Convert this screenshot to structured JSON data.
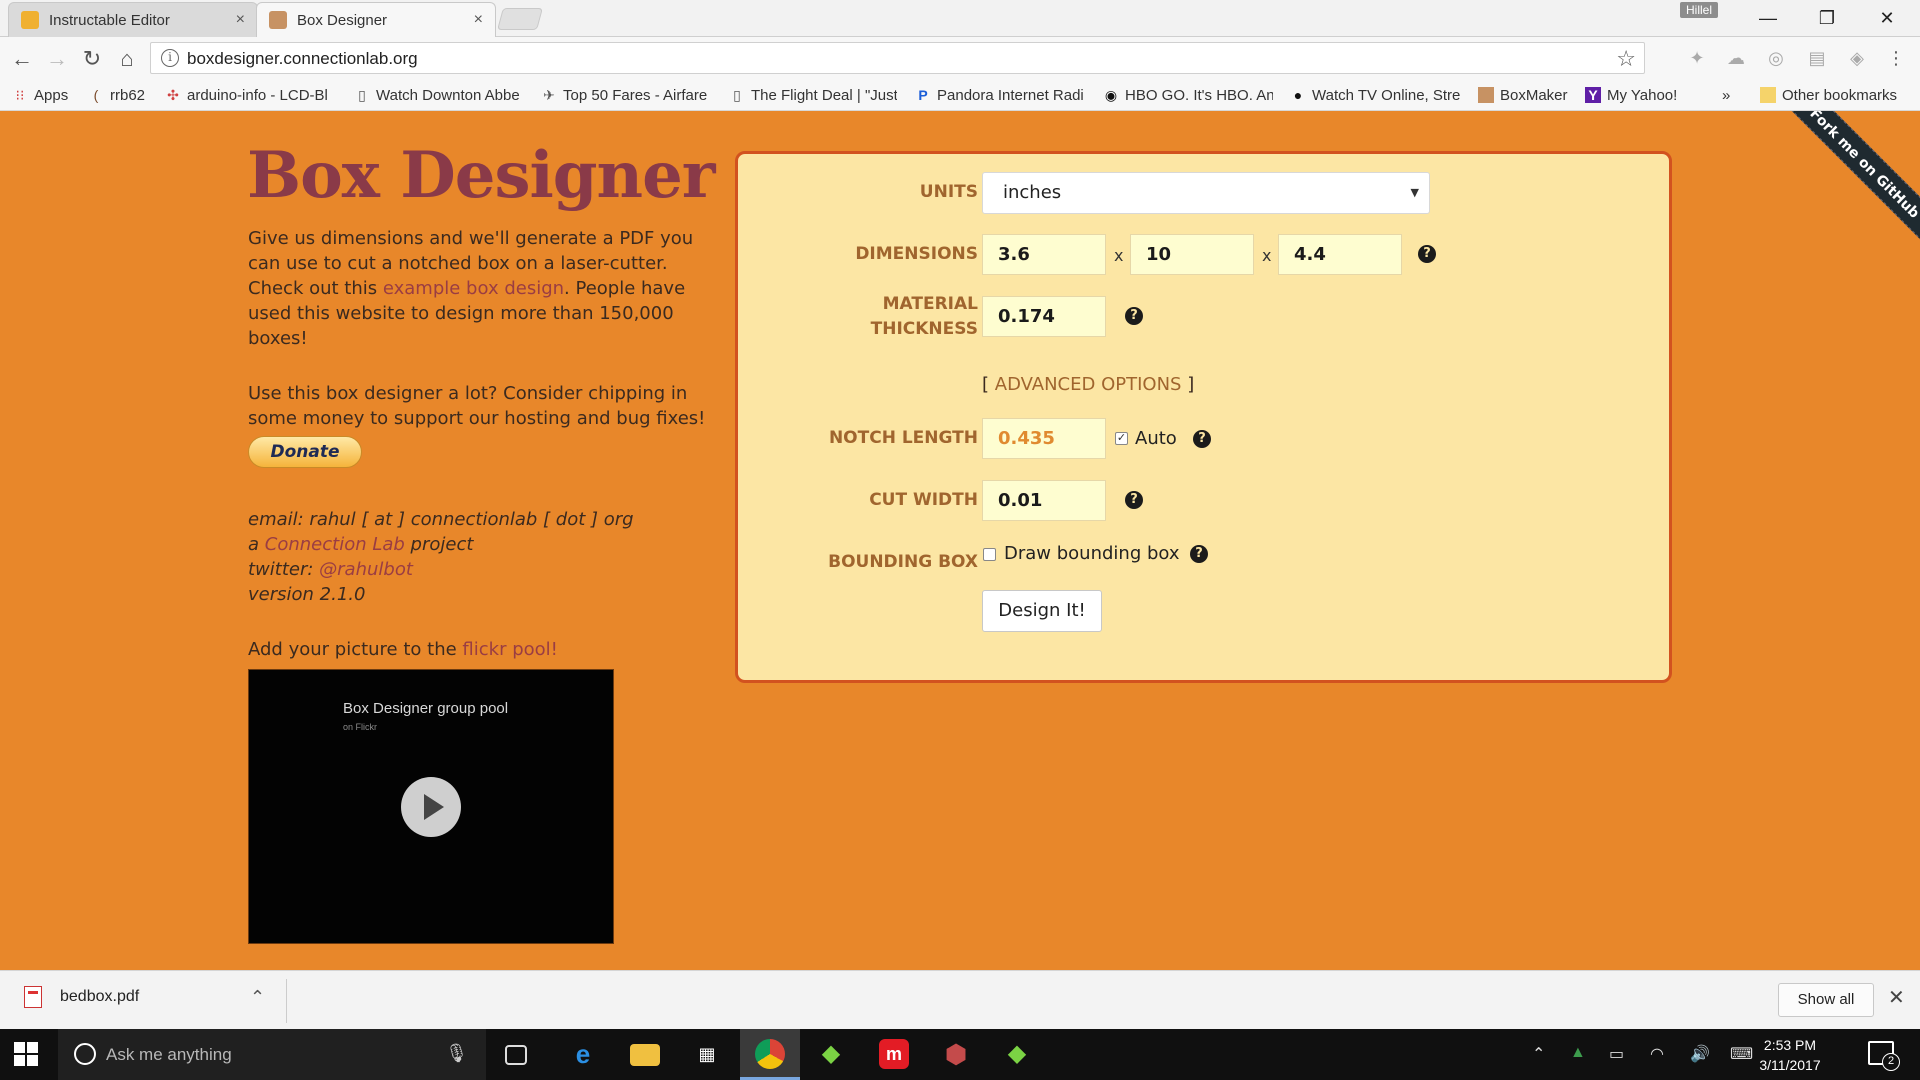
{
  "browser": {
    "tabs": [
      {
        "label": "Instructable Editor",
        "close": "×"
      },
      {
        "label": "Box Designer",
        "close": "×"
      }
    ],
    "profile_name": "Hillel",
    "window_buttons": {
      "minimize": "—",
      "restore": "❐",
      "close": "✕"
    },
    "url": "boxdesigner.connectionlab.org",
    "bookmarks": [
      {
        "label": "Apps",
        "icon": "apps-grid-icon"
      },
      {
        "label": "rrb62",
        "icon": "bookmark-favicon"
      },
      {
        "label": "arduino-info - LCD-Bl",
        "icon": "bookmark-favicon"
      },
      {
        "label": "Watch Downton Abbe",
        "icon": "page-icon"
      },
      {
        "label": "Top 50 Fares - Airfare",
        "icon": "plane-icon"
      },
      {
        "label": "The Flight Deal | \"Just",
        "icon": "page-icon"
      },
      {
        "label": "Pandora Internet Radi",
        "icon": "pandora-icon"
      },
      {
        "label": "HBO GO. It's HBO. An",
        "icon": "hbo-icon"
      },
      {
        "label": "Watch TV Online, Stre",
        "icon": "play-icon"
      },
      {
        "label": "BoxMaker",
        "icon": "boxmaker-icon"
      },
      {
        "label": "My Yahoo!",
        "icon": "yahoo-icon"
      }
    ],
    "bookmarks_overflow": "»",
    "other_bookmarks": "Other bookmarks"
  },
  "page": {
    "title": "Box Designer",
    "intro_before": "Give us dimensions and we'll generate a PDF you can use to cut a notched box on a laser-cutter. Check out this ",
    "intro_link": "example box design",
    "intro_after": ". People have used this website to design more than 150,000 boxes!",
    "donate_text": "Use this box designer a lot? Consider chipping in some money to support our hosting and bug fixes!",
    "donate_button": "Donate",
    "email_line": "email: rahul [ at ] connectionlab [ dot ] org",
    "project_prefix": "a ",
    "project_link": "Connection Lab",
    "project_suffix": " project",
    "twitter_prefix": "twitter: ",
    "twitter_link": "@rahulbot",
    "version": "version 2.1.0",
    "flickr_prefix": "Add your picture to the ",
    "flickr_link": "flickr pool!",
    "video_title": "Box Designer group pool",
    "video_subtitle": "on Flickr",
    "ribbon": "Fork me on GitHub"
  },
  "form": {
    "units_label": "UNITS",
    "units_value": "inches",
    "dimensions_label": "DIMENSIONS",
    "dim_width": "3.6",
    "dim_height": "10",
    "dim_depth": "4.4",
    "times": "x",
    "material_label_1": "MATERIAL",
    "material_label_2": "THICKNESS",
    "material_value": "0.174",
    "advanced_open": "[ ",
    "advanced_label": "ADVANCED OPTIONS",
    "advanced_close": " ]",
    "notch_label": "NOTCH LENGTH",
    "notch_value": "0.435",
    "auto_label": "Auto",
    "auto_checked": true,
    "cut_label": "CUT WIDTH",
    "cut_value": "0.01",
    "bbox_label": "BOUNDING BOX",
    "bbox_checkbox_label": "Draw bounding box",
    "bbox_checked": false,
    "design_button": "Design It!",
    "help_glyph": "?"
  },
  "downloads": {
    "file": "bedbox.pdf",
    "show_all": "Show all",
    "close": "✕"
  },
  "taskbar": {
    "search_placeholder": "Ask me anything",
    "time": "2:53 PM",
    "date": "3/11/2017",
    "notification_count": "2"
  },
  "colors": {
    "page_bg": "#e8872a",
    "title": "#8a3a48",
    "panel_bg": "#fce6a4",
    "panel_border": "#d2521f",
    "label": "#a0652e"
  }
}
